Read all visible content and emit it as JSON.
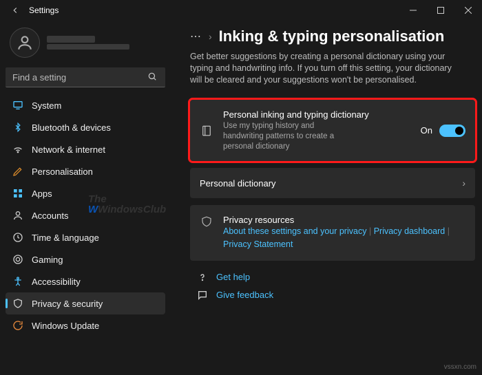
{
  "window": {
    "title": "Settings"
  },
  "profile": {
    "name": "",
    "email": ""
  },
  "search": {
    "placeholder": "Find a setting"
  },
  "sidebar": {
    "items": [
      {
        "icon": "display-icon",
        "label": "System",
        "active": false
      },
      {
        "icon": "bluetooth-icon",
        "label": "Bluetooth & devices",
        "active": false
      },
      {
        "icon": "wifi-icon",
        "label": "Network & internet",
        "active": false
      },
      {
        "icon": "personalise-icon",
        "label": "Personalisation",
        "active": false
      },
      {
        "icon": "apps-icon",
        "label": "Apps",
        "active": false
      },
      {
        "icon": "accounts-icon",
        "label": "Accounts",
        "active": false
      },
      {
        "icon": "time-icon",
        "label": "Time & language",
        "active": false
      },
      {
        "icon": "gaming-icon",
        "label": "Gaming",
        "active": false
      },
      {
        "icon": "accessibility-icon",
        "label": "Accessibility",
        "active": false
      },
      {
        "icon": "privacy-icon",
        "label": "Privacy & security",
        "active": true
      },
      {
        "icon": "update-icon",
        "label": "Windows Update",
        "active": false
      }
    ]
  },
  "breadcrumb": {
    "ellipsis": "⋯",
    "chevron": "›",
    "page": "Inking & typing personalisation"
  },
  "description": "Get better suggestions by creating a personal dictionary using your typing and handwriting info. If you turn off this setting, your dictionary will be cleared and your suggestions won't be personalised.",
  "cards": {
    "dictionary_toggle": {
      "title": "Personal inking and typing dictionary",
      "subtitle": "Use my typing history and handwriting patterns to create a personal dictionary",
      "toggle_label": "On",
      "toggle_on": true
    },
    "personal_dict": {
      "title": "Personal dictionary"
    },
    "privacy": {
      "title": "Privacy resources",
      "link1": "About these settings and your privacy",
      "link2": "Privacy dashboard",
      "link3": "Privacy Statement"
    }
  },
  "footer": {
    "help": "Get help",
    "feedback": "Give feedback"
  },
  "watermark": {
    "t1": "The",
    "t2": "WindowsClub"
  },
  "source": "vssxn.com"
}
